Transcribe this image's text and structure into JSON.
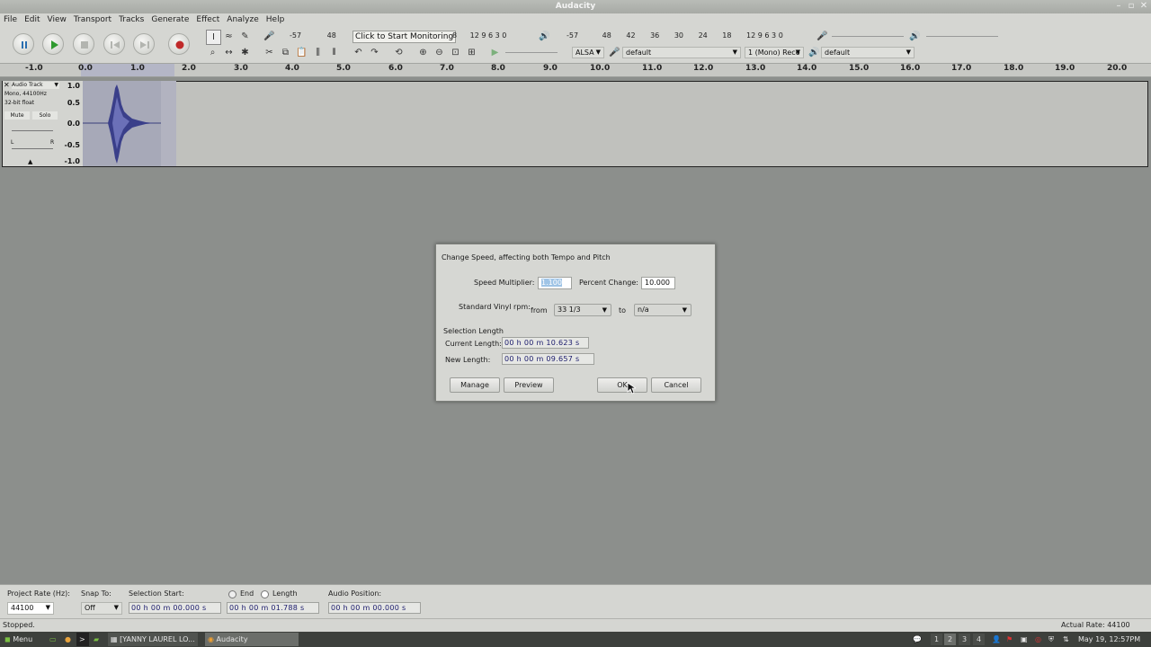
{
  "window": {
    "title": "Audacity"
  },
  "menu": [
    "File",
    "Edit",
    "View",
    "Transport",
    "Tracks",
    "Generate",
    "Effect",
    "Analyze",
    "Help"
  ],
  "meters": {
    "rec_ticks": [
      "-57",
      "48",
      "",
      "12",
      "9",
      "6",
      "3",
      "0"
    ],
    "monitor_tooltip": "Click to Start Monitoring",
    "monitor_tail": "8",
    "play_ticks": [
      "-57",
      "48",
      "42",
      "36",
      "30",
      "24",
      "18",
      "12",
      "9",
      "6",
      "3",
      "0"
    ]
  },
  "device": {
    "host": "ALSA",
    "recording_device": "default",
    "channels": "1 (Mono) Reco",
    "playback_device": "default"
  },
  "ruler_ticks": [
    "-1.0",
    "0.0",
    "1.0",
    "2.0",
    "3.0",
    "4.0",
    "5.0",
    "6.0",
    "7.0",
    "8.0",
    "9.0",
    "10.0",
    "11.0",
    "12.0",
    "13.0",
    "14.0",
    "15.0",
    "16.0",
    "17.0",
    "18.0",
    "19.0",
    "20.0"
  ],
  "track": {
    "name": "Audio Track",
    "info1": "Mono, 44100Hz",
    "info2": "32-bit float",
    "mute": "Mute",
    "solo": "Solo",
    "left": "L",
    "right": "R",
    "scale": [
      "1.0",
      "0.5",
      "0.0",
      "-0.5",
      "-1.0"
    ]
  },
  "dialog": {
    "title": "Change Speed, affecting both Tempo and Pitch",
    "speed_multiplier_label": "Speed Multiplier:",
    "speed_multiplier_value": "1.100",
    "percent_change_label": "Percent Change:",
    "percent_change_value": "10.000",
    "vinyl_label": "Standard Vinyl rpm:",
    "from_label": "from",
    "from_value": "33 1/3",
    "to_label": "to",
    "to_value": "n/a",
    "selection_length_label": "Selection Length",
    "current_length_label": "Current Length:",
    "current_length_value": "00 h 00 m 10.623 s",
    "new_length_label": "New Length:",
    "new_length_value": "00 h 00 m 09.657 s",
    "manage_button": "Manage",
    "preview_button": "Preview",
    "ok_button": "OK",
    "cancel_button": "Cancel"
  },
  "selection_toolbar": {
    "project_rate_label": "Project Rate (Hz):",
    "project_rate_value": "44100",
    "snap_to_label": "Snap To:",
    "snap_to_value": "Off",
    "selection_start_label": "Selection Start:",
    "end_label": "End",
    "length_label": "Length",
    "audio_position_label": "Audio Position:",
    "selection_start_value": "00 h 00 m 00.000 s",
    "selection_end_value": "00 h 00 m 01.788 s",
    "audio_position_value": "00 h 00 m 00.000 s"
  },
  "status": {
    "state": "Stopped.",
    "actual_rate": "Actual Rate: 44100"
  },
  "taskbar": {
    "menu_label": "Menu",
    "task1": "[YANNY LAUREL LO...",
    "task2": "Audacity",
    "workspaces": [
      "1",
      "2",
      "3",
      "4"
    ],
    "clock": "May 19, 12:57PM"
  }
}
